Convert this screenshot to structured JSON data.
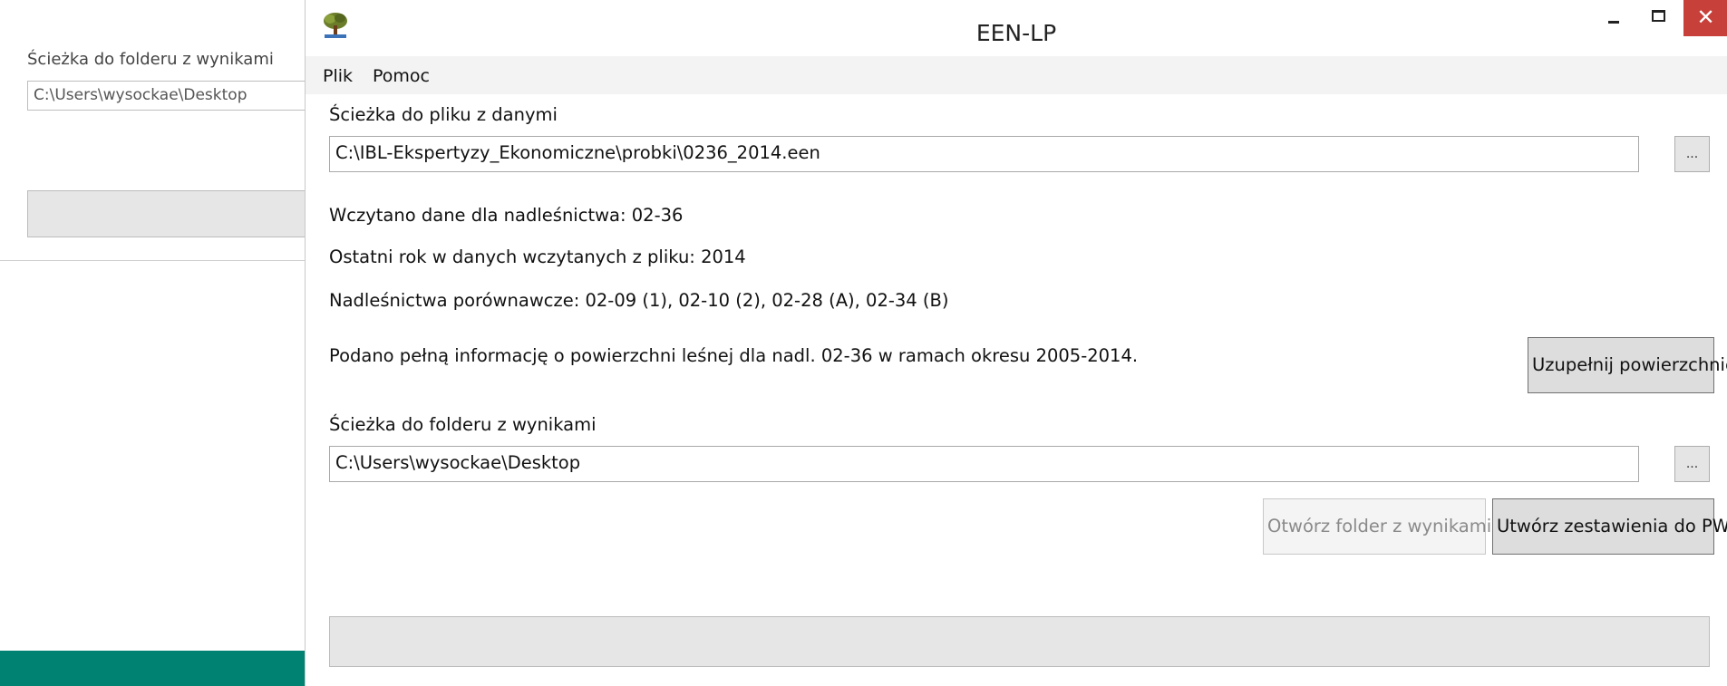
{
  "background_window": {
    "folder_label": "Ścieżka do folderu z wynikami",
    "folder_value": "C:\\Users\\wysockae\\Desktop"
  },
  "window": {
    "title": "EEN-LP",
    "close_glyph": "✕"
  },
  "menu": {
    "items": [
      "Plik",
      "Pomoc"
    ]
  },
  "data_file": {
    "label": "Ścieżka do pliku z danymi",
    "value": "C:\\IBL-Ekspertyzy_Ekonomiczne\\probki\\0236_2014.een",
    "browse_label": "..."
  },
  "info": {
    "loaded": "Wczytano dane dla nadleśnictwa:  02-36",
    "last_year": "Ostatni rok w danych wczytanych z pliku:  2014",
    "comparative": "Nadleśnictwa porównawcze:  02-09 (1), 02-10 (2), 02-28 (A), 02-34 (B)",
    "area_info": "Podano pełną informację o powierzchni leśnej dla nadl. 02-36 w ramach okresu 2005-2014."
  },
  "buttons": {
    "fill_area": "Uzupełnij powierzchnię",
    "open_folder": "Otwórz folder z wynikami",
    "create_reports": "Utwórz zestawienia do PWF"
  },
  "output_folder": {
    "label": "Ścieżka do folderu z wynikami",
    "value": "C:\\Users\\wysockae\\Desktop",
    "browse_label": "..."
  },
  "progress": {
    "value": 0
  },
  "colors": {
    "close_button": "#c7403a",
    "taskbar_green": "#008272",
    "menu_bar": "#f3f3f3"
  }
}
